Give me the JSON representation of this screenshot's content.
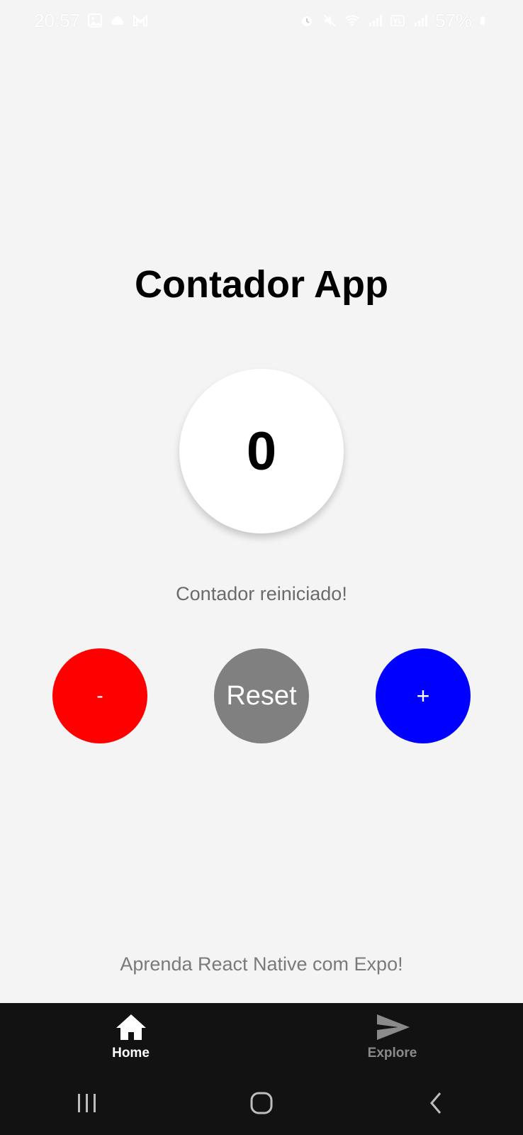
{
  "status_bar": {
    "time": "20:57",
    "battery": "57%",
    "left_icons": [
      "gallery-icon",
      "cloud-icon",
      "gmail-icon"
    ],
    "right_icons": [
      "alarm-icon",
      "mute-icon",
      "wifi-icon",
      "signal-icon",
      "volte-icon",
      "signal-icon",
      "battery-icon"
    ]
  },
  "main": {
    "title": "Contador App",
    "counter_value": "0",
    "message": "Contador reiniciado!",
    "buttons": {
      "minus_label": "-",
      "reset_label": "Reset",
      "plus_label": "+"
    },
    "footer_text": "Aprenda React Native com Expo!"
  },
  "tabs": [
    {
      "label": "Home",
      "icon": "home-icon",
      "active": true
    },
    {
      "label": "Explore",
      "icon": "send-icon",
      "active": false
    }
  ],
  "nav": {
    "buttons": [
      "recents-icon",
      "home-nav-icon",
      "back-icon"
    ]
  },
  "colors": {
    "background": "#f4f4f4",
    "minus": "#ff0000",
    "reset": "#808080",
    "plus": "#0000ff",
    "tab_bar": "#121212"
  }
}
